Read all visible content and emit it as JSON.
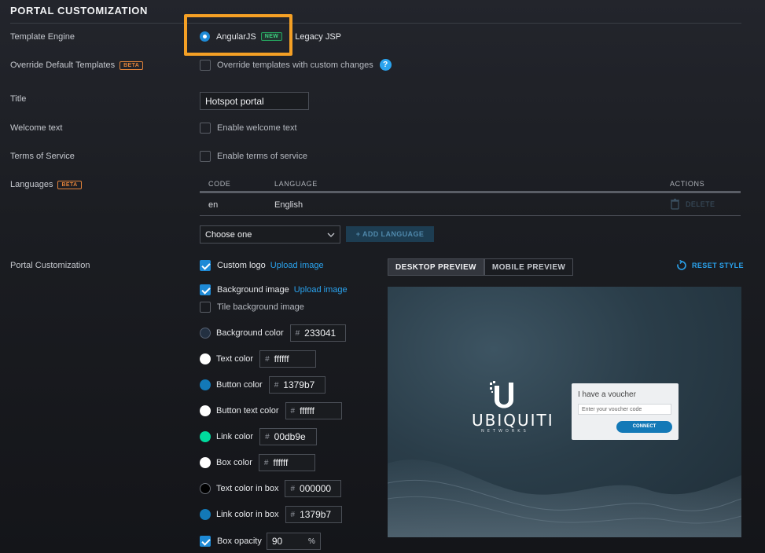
{
  "section": {
    "title": "PORTAL CUSTOMIZATION"
  },
  "template_engine": {
    "label": "Template Engine",
    "option_angular": "AngularJS",
    "option_angular_badge": "NEW",
    "option_legacy": "Legacy JSP",
    "selected": "AngularJS"
  },
  "override": {
    "label": "Override Default Templates",
    "badge": "BETA",
    "checkbox_label": "Override templates with custom changes",
    "checked": false,
    "help_icon": "question-circle-icon"
  },
  "title_field": {
    "label": "Title",
    "value": "Hotspot portal"
  },
  "welcome": {
    "label": "Welcome text",
    "checkbox_label": "Enable welcome text",
    "checked": false
  },
  "terms": {
    "label": "Terms of Service",
    "checkbox_label": "Enable terms of service",
    "checked": false
  },
  "languages": {
    "label": "Languages",
    "badge": "BETA",
    "columns": {
      "code": "CODE",
      "language": "LANGUAGE",
      "actions": "ACTIONS"
    },
    "rows": [
      {
        "code": "en",
        "language": "English",
        "action": "DELETE"
      }
    ],
    "select_value": "Choose one",
    "add_button": "+ ADD LANGUAGE"
  },
  "customization": {
    "label": "Portal Customization",
    "custom_logo": {
      "label": "Custom logo",
      "link": "Upload image",
      "checked": true
    },
    "background_image": {
      "label": "Background image",
      "link": "Upload image",
      "checked": true
    },
    "tile_background": {
      "label": "Tile background image",
      "checked": false
    },
    "colors": [
      {
        "label": "Background color",
        "hex": "233041",
        "swatch": "#233041"
      },
      {
        "label": "Text color",
        "hex": "ffffff",
        "swatch": "#ffffff"
      },
      {
        "label": "Button color",
        "hex": "1379b7",
        "swatch": "#1379b7"
      },
      {
        "label": "Button text color",
        "hex": "ffffff",
        "swatch": "#ffffff"
      },
      {
        "label": "Link color",
        "hex": "00db9e",
        "swatch": "#00db9e"
      },
      {
        "label": "Box color",
        "hex": "ffffff",
        "swatch": "#ffffff"
      },
      {
        "label": "Text color in box",
        "hex": "000000",
        "swatch": "#000000"
      },
      {
        "label": "Link color in box",
        "hex": "1379b7",
        "swatch": "#1379b7"
      }
    ],
    "box_opacity": {
      "label": "Box opacity",
      "value": "90",
      "unit": "%",
      "checked": true
    },
    "hash": "#"
  },
  "preview": {
    "tab_desktop": "DESKTOP PREVIEW",
    "tab_mobile": "MOBILE PREVIEW",
    "active_tab": "DESKTOP PREVIEW",
    "reset": "RESET STYLE",
    "logo_text": "UBIQUITI",
    "logo_sub": "NETWORKS",
    "voucher_title": "I have a voucher",
    "voucher_placeholder": "Enter your voucher code",
    "connect": "CONNECT"
  }
}
